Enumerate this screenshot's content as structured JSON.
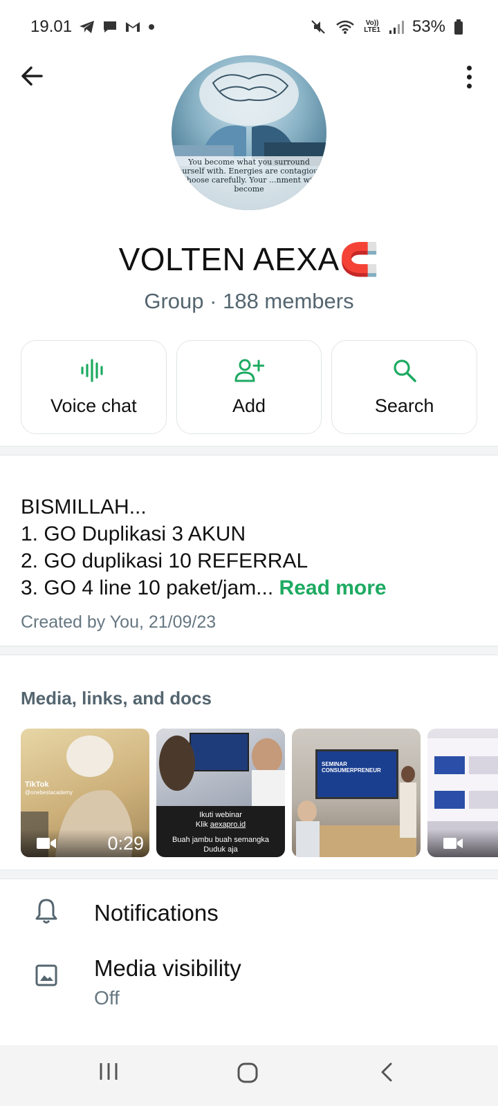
{
  "status_bar": {
    "time": "19.01",
    "battery": "53%",
    "network_label_top": "Vo))",
    "network_label_bottom": "LTE1",
    "left_icons": [
      "telegram-icon",
      "chat-icon",
      "gmail-icon",
      "dot-icon"
    ],
    "right_icons": [
      "mute-icon",
      "wifi-icon",
      "signal-icon",
      "battery-icon"
    ]
  },
  "header": {
    "back_icon": "arrow-left-icon",
    "menu_icon": "more-vert-icon"
  },
  "avatar": {
    "caption": "You become what you surround yourself with. Energies are contagious. Choose carefully. Your ...nment will become"
  },
  "group": {
    "name": "VOLTEN AEXA🧲",
    "subtitle": "Group · 188 members"
  },
  "actions": [
    {
      "label": "Voice chat",
      "icon": "voice-wave-icon"
    },
    {
      "label": "Add",
      "icon": "person-add-icon"
    },
    {
      "label": "Search",
      "icon": "search-icon"
    }
  ],
  "description": {
    "lines": [
      "BISMILLAH...",
      "1. GO Duplikasi 3 AKUN",
      "2. GO duplikasi 10 REFERRAL",
      "3. GO 4 line 10 paket/jam..."
    ],
    "read_more": "Read more",
    "created": "Created by You, 21/09/23"
  },
  "media": {
    "title": "Media, links, and docs",
    "items": [
      {
        "type": "video",
        "duration": "0:29",
        "overlay_brand": "TikTok",
        "overlay_handle": "@onebestacademy"
      },
      {
        "type": "image",
        "text_line1": "Ikuti webinar",
        "text_line2_prefix": "Klik ",
        "text_link": "aexapro.id",
        "text_line3": "Buah jambu buah semangka",
        "text_line4": "Duduk aja"
      },
      {
        "type": "image",
        "screen_title": "SEMINAR CONSUMERPRENEUR"
      },
      {
        "type": "video"
      }
    ]
  },
  "settings": [
    {
      "label": "Notifications",
      "icon": "bell-icon"
    },
    {
      "label": "Media visibility",
      "sub": "Off",
      "icon": "image-icon"
    }
  ],
  "nav": {
    "recent_icon": "recent-apps-icon",
    "home_icon": "home-icon",
    "back_icon": "nav-back-icon"
  },
  "colors": {
    "accent": "#1daa61",
    "text_primary": "#111b21",
    "text_secondary": "#667781"
  }
}
